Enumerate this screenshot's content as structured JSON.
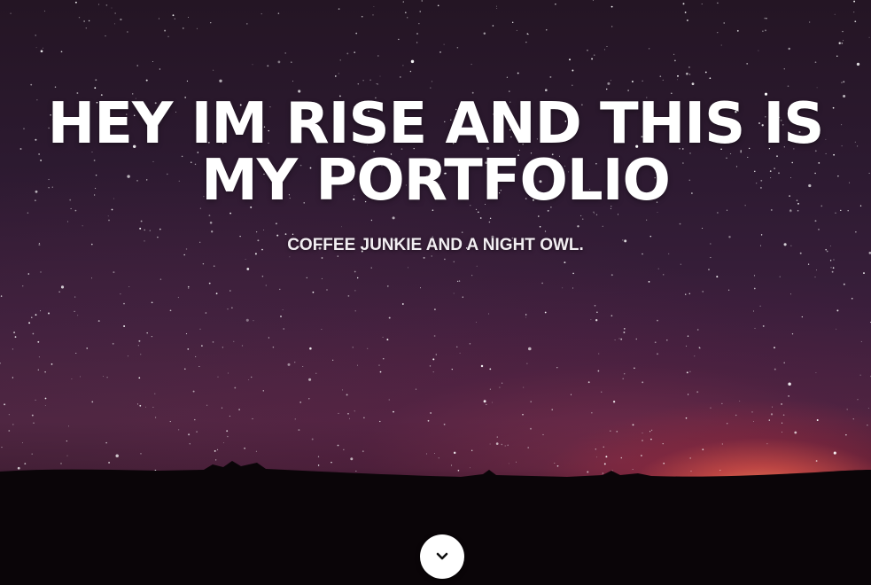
{
  "hero": {
    "title": "HEY IM RISE AND THIS IS MY PORTFOLIO",
    "subtitle": "COFFEE JUNKIE AND A NIGHT OWL.",
    "scroll_icon": "chevron-down-icon"
  },
  "colors": {
    "text": "#ffffff",
    "sky_top": "#241524",
    "sky_glow": "#ff8c5a",
    "ground": "#0a0508",
    "button_bg": "#ffffff",
    "button_icon": "#111111"
  }
}
